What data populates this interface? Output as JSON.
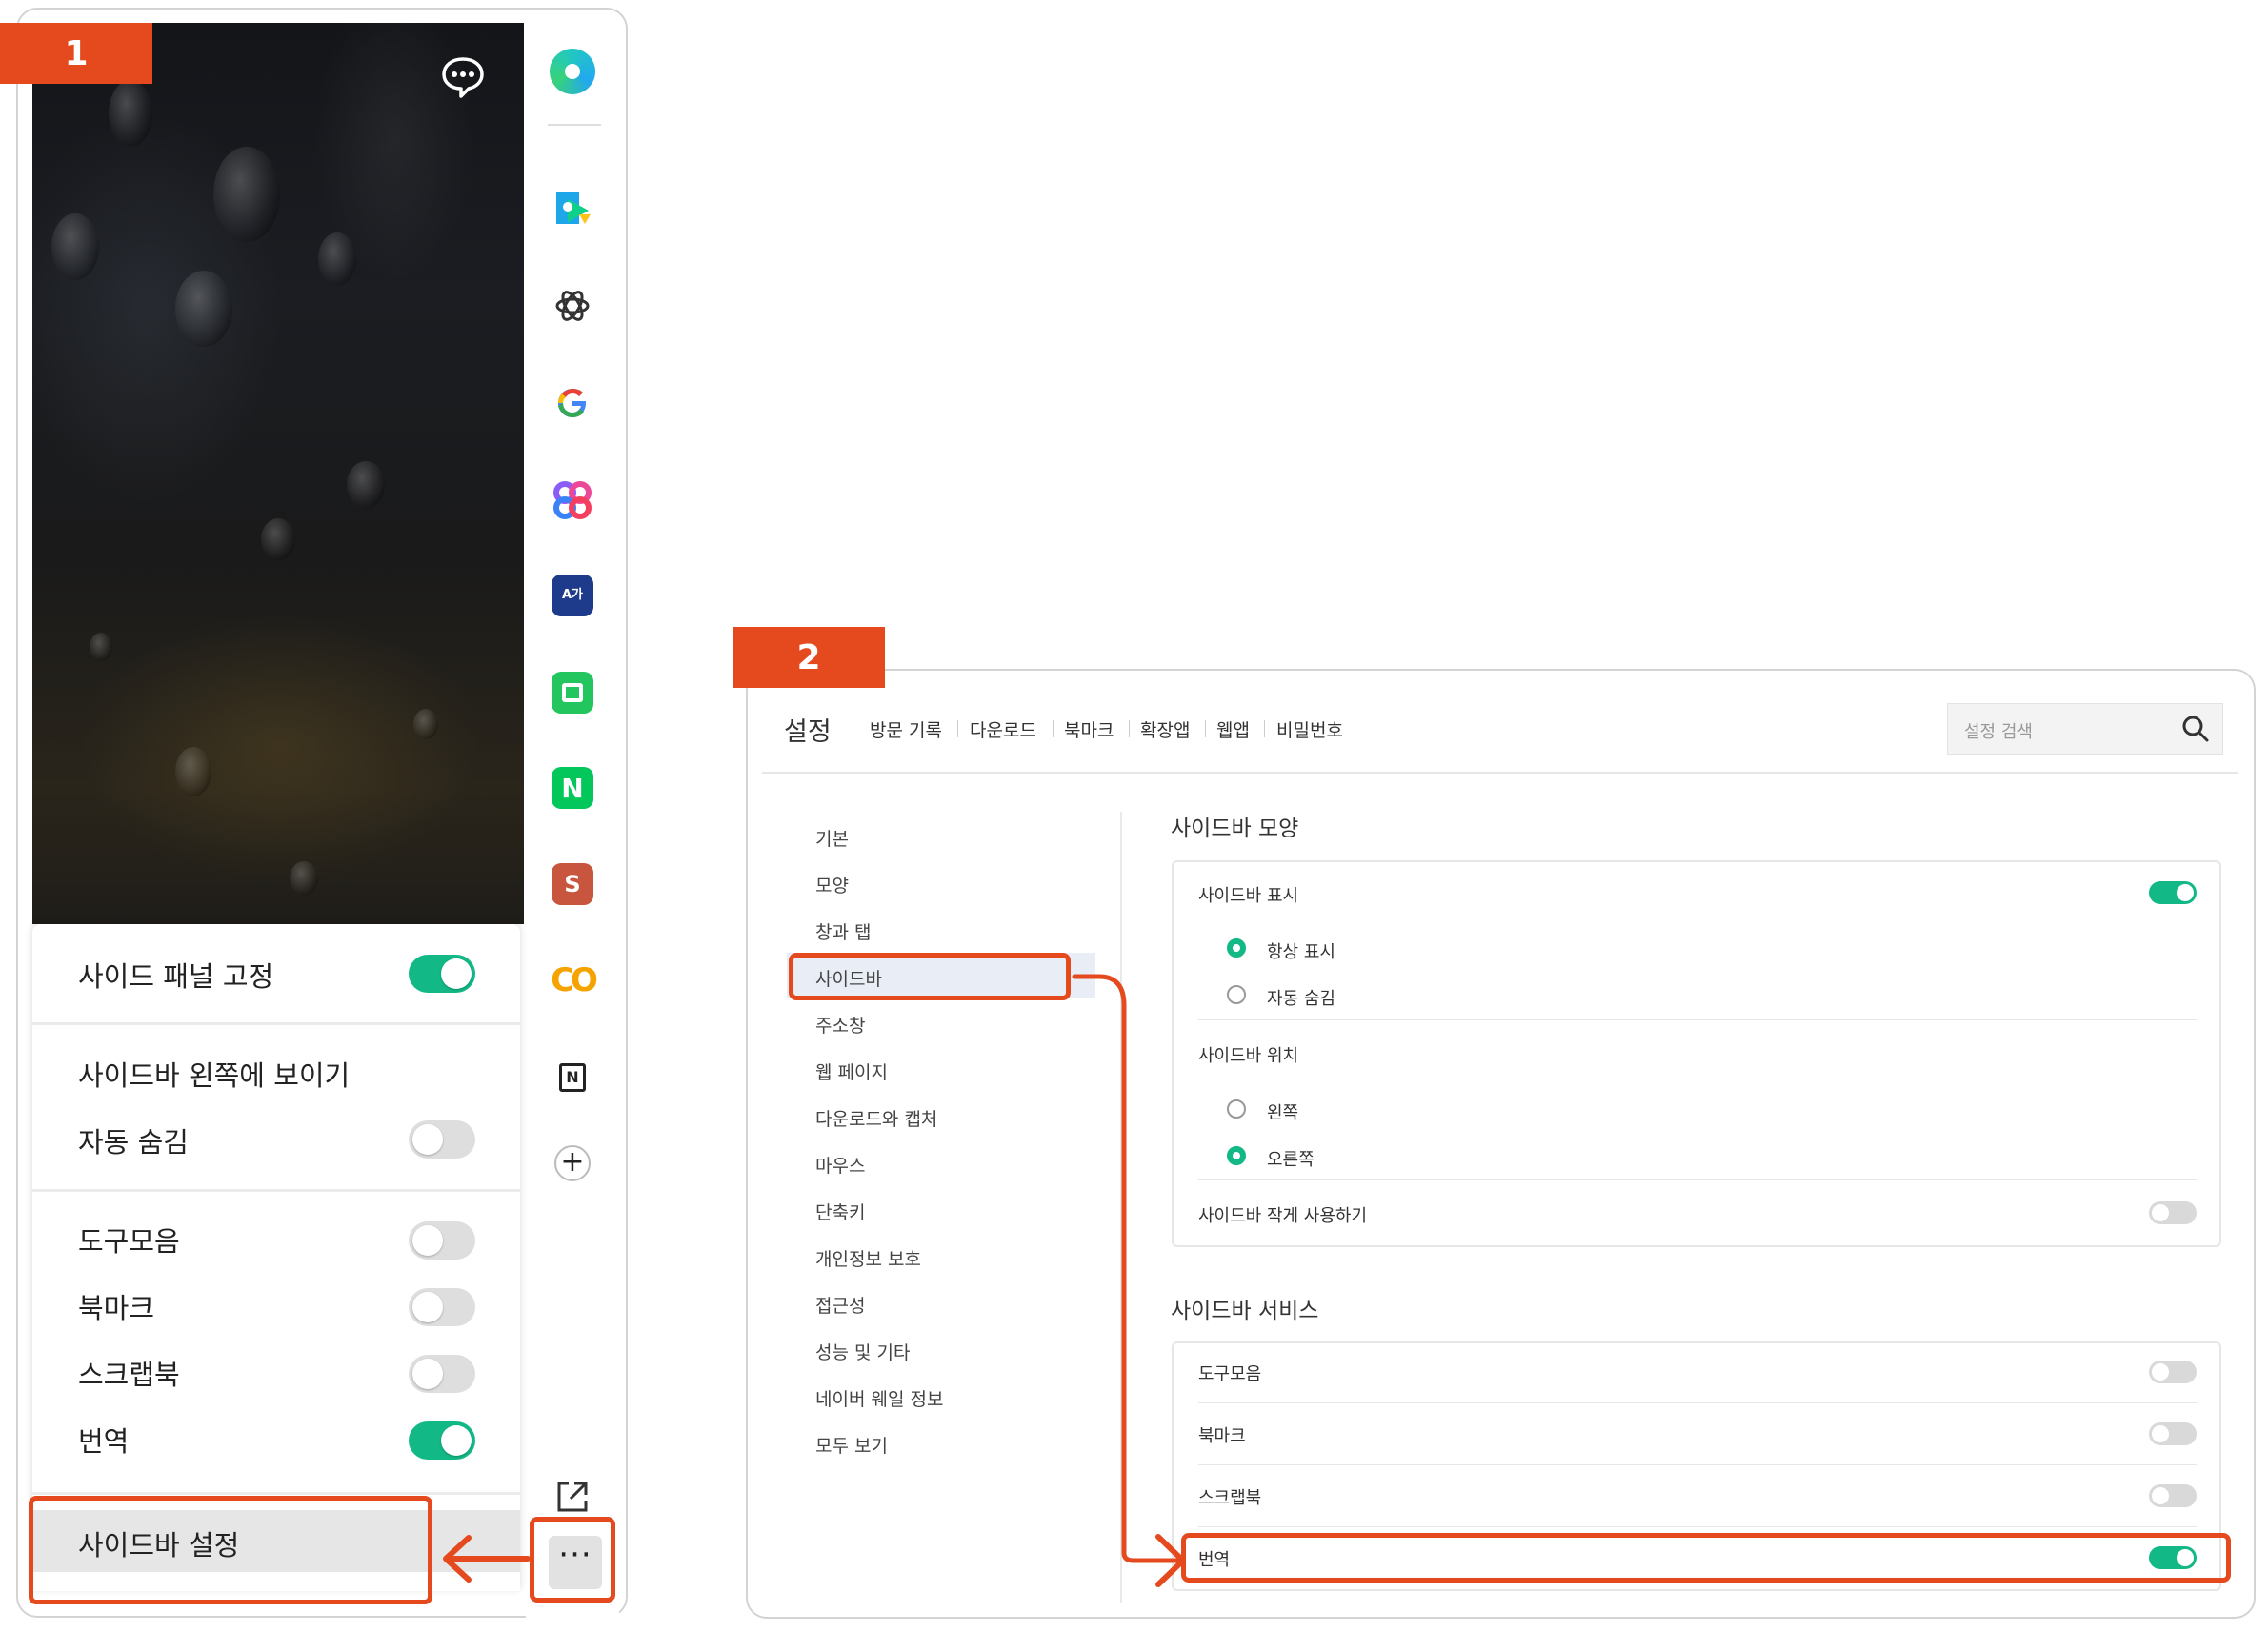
{
  "badges": {
    "one": "1",
    "two": "2"
  },
  "colors": {
    "accent_red": "#e44a1e",
    "toggle_on": "#12b886"
  },
  "panel1": {
    "rail_icons": [
      "naver-whale-icon",
      "papago-like-app-icon",
      "openai-icon",
      "google-icon",
      "colorful-app-icon",
      "papago-translate-icon",
      "green-calendar-icon",
      "naver-icon",
      "s-app-icon",
      "co-app-icon",
      "notion-icon",
      "add-icon"
    ],
    "rail_letters": {
      "s_app": "S",
      "co_app": "CO",
      "naver": "N",
      "translate": "A가"
    },
    "menu": {
      "pin_label": "사이드 패널 고정",
      "left_label": "사이드바 왼쪽에 보이기",
      "autohide_label": "자동 숨김",
      "toolbar_label": "도구모음",
      "bookmark_label": "북마크",
      "scrapbook_label": "스크랩북",
      "translate_label": "번역",
      "settings_label": "사이드바 설정"
    },
    "toggles": {
      "pin": true,
      "autohide": false,
      "toolbar": false,
      "bookmark": false,
      "scrapbook": false,
      "translate": true
    },
    "more_label": "···"
  },
  "panel2": {
    "title": "설정",
    "tabs": [
      "방문 기록",
      "다운로드",
      "북마크",
      "확장앱",
      "웹앱",
      "비밀번호"
    ],
    "search_placeholder": "설정 검색",
    "left_nav": [
      "기본",
      "모양",
      "창과 탭",
      "사이드바",
      "주소창",
      "웹 페이지",
      "다운로드와 캡처",
      "마우스",
      "단축키",
      "개인정보 보호",
      "접근성",
      "성능 및 기타",
      "네이버 웨일 정보",
      "모두 보기"
    ],
    "selected_nav": "사이드바",
    "appearance": {
      "title": "사이드바 모양",
      "show_label": "사이드바 표시",
      "show_on": true,
      "always_label": "항상 표시",
      "autohide_label": "자동 숨김",
      "display_mode": "항상 표시",
      "position_label": "사이드바 위치",
      "left_label": "왼쪽",
      "right_label": "오른쪽",
      "position": "오른쪽",
      "small_label": "사이드바 작게 사용하기",
      "small_on": false
    },
    "services": {
      "title": "사이드바 서비스",
      "items": [
        {
          "label": "도구모음",
          "on": false
        },
        {
          "label": "북마크",
          "on": false
        },
        {
          "label": "스크랩북",
          "on": false
        },
        {
          "label": "번역",
          "on": true
        }
      ]
    }
  }
}
